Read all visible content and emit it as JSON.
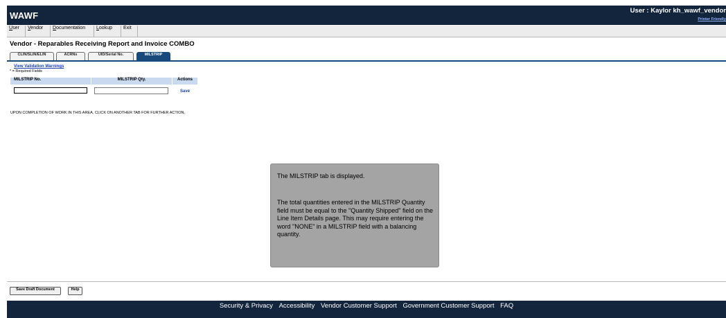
{
  "header": {
    "app_title": "WAWF",
    "user_info": "User : Kaylor kh_wawf_vendor",
    "printer_friendly": "Printer Friendly"
  },
  "menu": {
    "items": [
      {
        "underline": "U",
        "rest": "ser"
      },
      {
        "underline": "V",
        "rest": "endor"
      },
      {
        "underline": "D",
        "rest": "ocumentation"
      },
      {
        "underline": "L",
        "rest": "ookup"
      },
      {
        "underline": "",
        "rest": "Exit"
      }
    ]
  },
  "page": {
    "title": "Vendor - Reparables Receiving Report and Invoice COMBO"
  },
  "tabs": [
    {
      "label": "CLIN/SLIN/ELIN",
      "active": false
    },
    {
      "label": "ACRNs",
      "active": false
    },
    {
      "label": "UID/Serial No.",
      "active": false
    },
    {
      "label": "MILSTRIP",
      "active": true
    }
  ],
  "milstrip": {
    "view_warnings": "View Validation Warnings",
    "required_note": "* = Required Fields",
    "columns": [
      "MILSTRIP No.",
      "MILSTRIP Qty.",
      "Actions"
    ],
    "no_value": "",
    "qty_value": "",
    "save_label": "Save",
    "completion_note": "UPON COMPLETION OF WORK IN THIS AREA, CLICK ON ANOTHER TAB FOR FURTHER ACTION."
  },
  "tooltip": {
    "line1": "The MILSTRIP tab is displayed.",
    "line2": "The total quantities entered in the MILSTRIP Quantity field must be equal to the \"Quantity Shipped\" field on the Line Item Details page. This may require entering the word \"NONE\" in a MILSTRIP field with a balancing quantity."
  },
  "buttons": {
    "save_draft": "Save Draft Document",
    "help": "Help"
  },
  "footer": {
    "links": [
      "Security & Privacy",
      "Accessibility",
      "Vendor Customer Support",
      "Government Customer Support",
      "FAQ"
    ]
  },
  "colors": {
    "header_bg": "#13243d",
    "active_tab": "#1a4a7c",
    "table_header": "#c9d9f0",
    "link": "#1a3fb0",
    "tooltip_bg": "#a4a4a4"
  }
}
